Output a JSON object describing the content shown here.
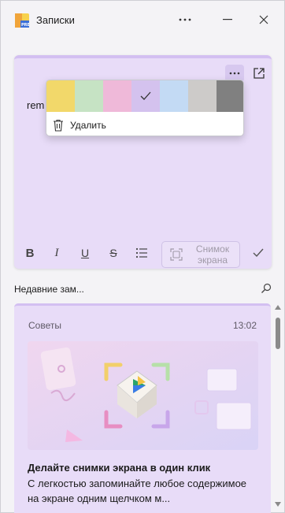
{
  "window": {
    "title": "Записки",
    "icon": "sticky-notes-app-icon",
    "controls": [
      "more-icon",
      "minimize-icon",
      "close-icon"
    ]
  },
  "note": {
    "text": "rem",
    "toolbar": {
      "bold": "B",
      "italic": "I",
      "underline": "U",
      "strikethrough": "S",
      "list": "list-icon",
      "screenshot_label": "Снимок экрана"
    },
    "menu": {
      "colors": [
        "#f2d86a",
        "#c6e3c4",
        "#efb9d9",
        "#d4c2ee",
        "#c3daf4",
        "#cdcbc9",
        "#808080"
      ],
      "selected_index": 3,
      "delete_label": "Удалить"
    }
  },
  "recent": {
    "title": "Недавние зам...",
    "card": {
      "label": "Советы",
      "time": "13:02",
      "heading": "Делайте снимки экрана в один клик",
      "body": "С легкостью запоминайте любое содержимое на экране одним щелчком м..."
    }
  },
  "colors": {
    "note_background": "#e8dcf8",
    "note_accent": "#d3bff1",
    "window_background": "#f4f3f6"
  }
}
